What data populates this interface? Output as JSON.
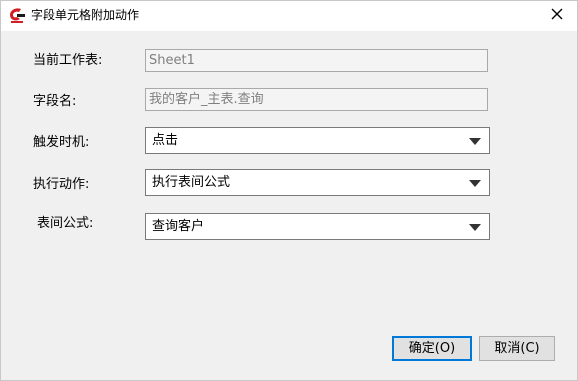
{
  "window": {
    "title": "字段单元格附加动作",
    "close_glyph": "✕"
  },
  "form": {
    "worksheet": {
      "label": "当前工作表:",
      "value": "Sheet1"
    },
    "field_name": {
      "label": "字段名:",
      "value": "我的客户_主表.查询"
    },
    "trigger": {
      "label": "触发时机:",
      "selected": "点击"
    },
    "action": {
      "label": "执行动作:",
      "selected": "执行表间公式"
    },
    "formula": {
      "label": "表间公式:",
      "selected": "查询客户"
    }
  },
  "buttons": {
    "ok_label": "确定(O)",
    "cancel_label": "取消(C)"
  },
  "icons": {
    "app": "app-logo-icon",
    "close": "close-icon",
    "dropdown": "chevron-down-icon"
  },
  "colors": {
    "accent": "#0078d7",
    "logo_red": "#d21f26"
  }
}
